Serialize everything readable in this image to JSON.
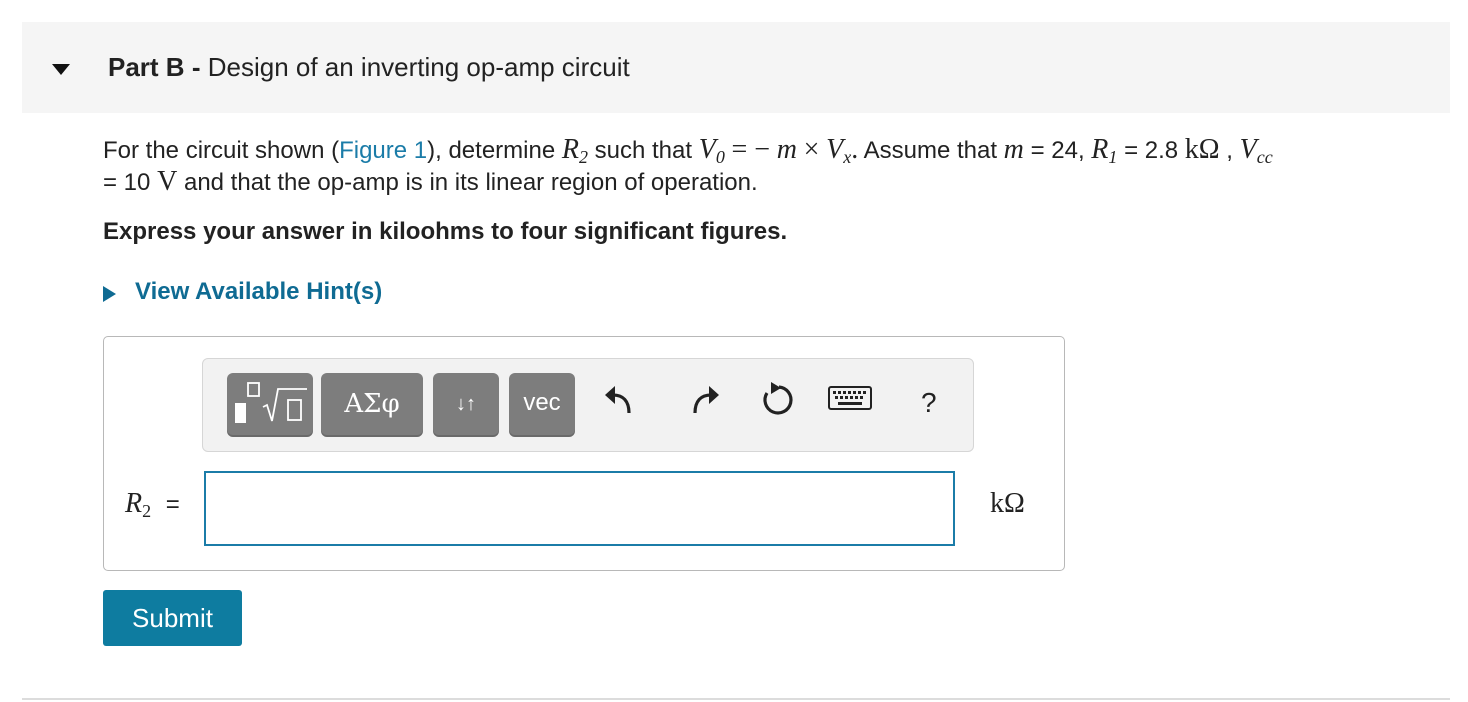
{
  "part": {
    "label": "Part B",
    "separator": "-",
    "title": "Design of an inverting op-amp circuit"
  },
  "problem": {
    "line1_intro": "For the circuit shown (",
    "figure_link": "Figure 1",
    "line1_after_link": "), determine",
    "r2_var": "R",
    "r2_sub": "2",
    "such_that": "such that",
    "vo_var": "V",
    "vo_sub": "0",
    "eq_part": "= −",
    "m_var": "m",
    "times": "×",
    "vx_var": "V",
    "vx_sub": "x",
    "dot": ".",
    "assume": "Assume that",
    "m_var2": "m",
    "m_eq": "= 24,",
    "r1_var": "R",
    "r1_sub": "1",
    "r1_eq": "= 2.8",
    "r1_unit": "kΩ",
    "comma": ",",
    "vcc_var": "V",
    "vcc_sub": "cc",
    "line2_eq": "= 10",
    "line2_unit": "V",
    "line2_rest": "and that the op-amp is in its linear region of operation."
  },
  "instruction": "Express your answer in kiloohms to four significant figures.",
  "hint": {
    "label": "View Available Hint(s)"
  },
  "toolbar": {
    "greek_label": "ΑΣφ",
    "arrows_label": "↓↑",
    "vec_label": "vec",
    "help_label": "?"
  },
  "answer": {
    "var": "R",
    "sub": "2",
    "eq": "=",
    "value": "",
    "unit": "kΩ"
  },
  "submit": {
    "label": "Submit"
  },
  "colors": {
    "accent": "#0e7ca0",
    "link": "#1b7ca8",
    "toolbar_button": "#7d7d7d"
  }
}
